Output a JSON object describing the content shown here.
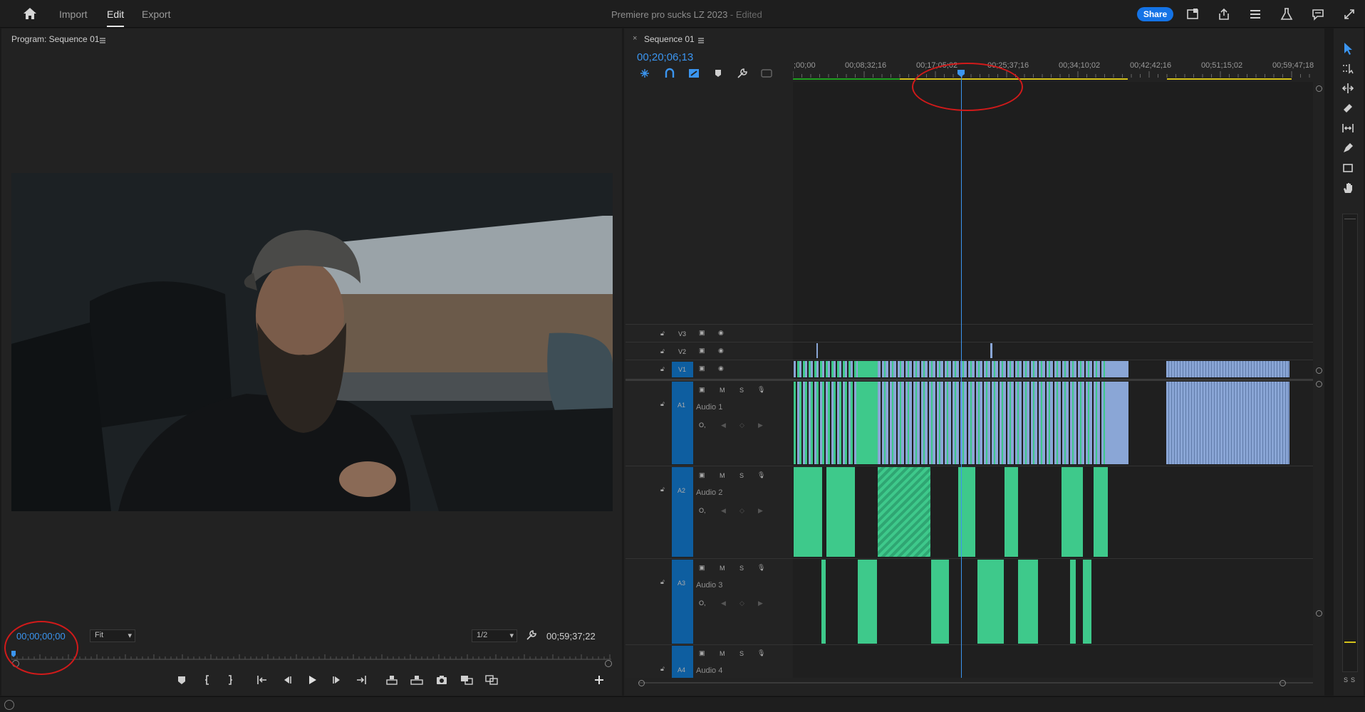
{
  "nav": {
    "tabs": [
      {
        "label": "Import"
      },
      {
        "label": "Edit"
      },
      {
        "label": "Export"
      }
    ],
    "active_tab": "Edit"
  },
  "document": {
    "title": "Premiere pro sucks LZ 2023",
    "status": "- Edited"
  },
  "topbar": {
    "share_label": "Share",
    "icons": [
      "home-icon",
      "quick-export-icon",
      "publish-icon",
      "workspaces-icon",
      "beta-flask-icon",
      "feedback-icon",
      "fullscreen-icon"
    ]
  },
  "program_monitor": {
    "title": "Program: Sequence 01",
    "menu_icon": "hamburger-icon",
    "current_timecode": "00;00;00;00",
    "zoom": "Fit",
    "zoom_options": [
      "Fit"
    ],
    "resolution": "1/2",
    "duration": "00;59;37;22",
    "playhead_fraction": 0.0,
    "controls": [
      "add-marker-icon",
      "mark-in-icon",
      "mark-out-icon",
      "go-to-in-icon",
      "step-back-icon",
      "play-icon",
      "step-forward-icon",
      "go-to-out-icon",
      "lift-icon",
      "extract-icon",
      "export-frame-icon",
      "compare-view-icon",
      "multi-camera-icon",
      "add-button-icon"
    ]
  },
  "timeline": {
    "tab_title": "Sequence 01",
    "current_timecode": "00;20;06;13",
    "ruler_labels": [
      ";00;00",
      "00;08;32;16",
      "00;17;05;02",
      "00;25;37;16",
      "00;34;10;02",
      "00;42;42;16",
      "00;51;15;02",
      "00;59;47;18"
    ],
    "playhead_fraction": 0.335,
    "video_tracks": [
      {
        "id": "V3"
      },
      {
        "id": "V2"
      },
      {
        "id": "V1"
      }
    ],
    "audio_tracks": [
      {
        "id": "A1",
        "name": "Audio 1"
      },
      {
        "id": "A2",
        "name": "Audio 2"
      },
      {
        "id": "A3",
        "name": "Audio 3"
      },
      {
        "id": "A4",
        "name": "Audio 4"
      }
    ],
    "track_buttons": {
      "mute": "M",
      "solo": "S"
    }
  },
  "tools": {
    "icons": [
      "selection-tool-icon",
      "track-select-tool-icon",
      "ripple-edit-tool-icon",
      "razor-tool-icon",
      "slip-tool-icon",
      "pen-tool-icon",
      "rectangle-tool-icon",
      "hand-tool-icon"
    ],
    "meter_labels": [
      "S",
      "S"
    ]
  },
  "colors": {
    "accent": "#3b95f0",
    "share": "#1473e6",
    "video_clip_blue": "#8aa6d6",
    "audio_clip_green": "#3ec98b",
    "annotation_red": "#d11a1a"
  }
}
